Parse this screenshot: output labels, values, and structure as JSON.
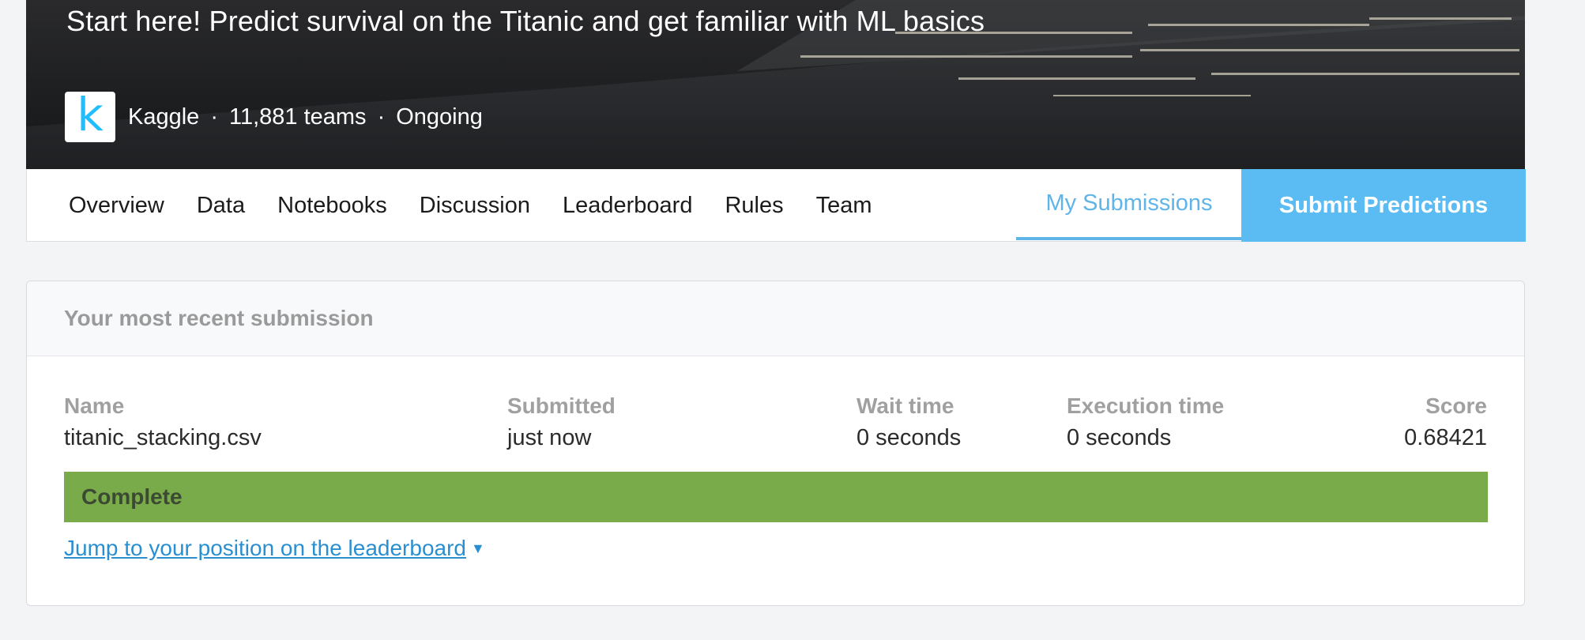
{
  "hero": {
    "title": "Start here! Predict survival on the Titanic and get familiar with ML basics",
    "logo_letter": "k",
    "host": "Kaggle",
    "separator": "·",
    "teams": "11,881 teams",
    "status": "Ongoing"
  },
  "nav": {
    "tabs": [
      {
        "label": "Overview"
      },
      {
        "label": "Data"
      },
      {
        "label": "Notebooks"
      },
      {
        "label": "Discussion"
      },
      {
        "label": "Leaderboard"
      },
      {
        "label": "Rules"
      },
      {
        "label": "Team"
      }
    ],
    "my_submissions": "My Submissions",
    "submit_predictions": "Submit Predictions"
  },
  "submission": {
    "header": "Your most recent submission",
    "columns": {
      "name": {
        "label": "Name",
        "value": "titanic_stacking.csv"
      },
      "submitted": {
        "label": "Submitted",
        "value": "just now"
      },
      "wait_time": {
        "label": "Wait time",
        "value": "0 seconds"
      },
      "execution_time": {
        "label": "Execution time",
        "value": "0 seconds"
      },
      "score": {
        "label": "Score",
        "value": "0.68421"
      }
    },
    "status": "Complete",
    "jump_link": "Jump to your position on the leaderboard"
  },
  "colors": {
    "accent": "#5bbcf3",
    "status_complete": "#7aab4b",
    "link": "#2a8fd0"
  },
  "icons": {
    "caret": "caret-down-icon"
  }
}
